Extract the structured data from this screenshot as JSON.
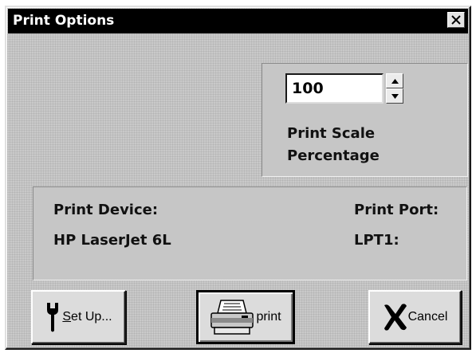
{
  "window": {
    "title": "Print Options",
    "close_label": "×"
  },
  "scale": {
    "value": "100",
    "label_line1": "Print Scale",
    "label_line2": "Percentage"
  },
  "device": {
    "device_label": "Print Device:",
    "device_value": "HP LaserJet 6L",
    "port_label": "Print Port:",
    "port_value": "LPT1:"
  },
  "buttons": {
    "setup_mnemonic": "S",
    "setup_rest": "et Up...",
    "print_label": "print",
    "cancel_label": "Cancel"
  },
  "icons": {
    "close": "close-icon",
    "spin_up": "arrow-up-icon",
    "spin_down": "arrow-down-icon",
    "setup": "wrench-icon",
    "print": "printer-icon",
    "cancel": "x-mark-icon"
  }
}
